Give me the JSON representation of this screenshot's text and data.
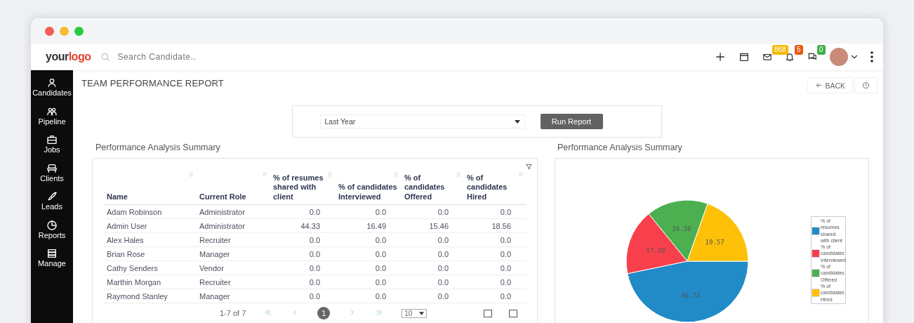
{
  "header": {
    "logo_dark": "your",
    "logo_accent": "logo",
    "search": {
      "placeholder": "Search Candidate.."
    },
    "badges": [
      {
        "count": "868",
        "color": "#f5b800"
      },
      {
        "count": "5",
        "color": "#e8590c"
      },
      {
        "count": "0",
        "color": "#3fae49"
      }
    ]
  },
  "sidebar": {
    "items": [
      {
        "label": "Candidates"
      },
      {
        "label": "Pipeline"
      },
      {
        "label": "Jobs"
      },
      {
        "label": "Clients"
      },
      {
        "label": "Leads"
      },
      {
        "label": "Reports"
      },
      {
        "label": "Manage"
      }
    ]
  },
  "page": {
    "title": "TEAM PERFORMANCE REPORT",
    "back_button": "BACK"
  },
  "filter": {
    "period": "Last Year",
    "run_button": "Run Report"
  },
  "table_section": {
    "heading": "Performance Analysis Summary",
    "columns": [
      "Name",
      "Current Role",
      "% of resumes shared with client",
      "% of candidates Interviewed",
      "% of candidates Offered",
      "% of candidates Hired"
    ],
    "rows": [
      [
        "Adam Robinson",
        "Administrator",
        "0.0",
        "0.0",
        "0.0",
        "0.0"
      ],
      [
        "Admin User",
        "Administrator",
        "44.33",
        "16.49",
        "15.46",
        "18.56"
      ],
      [
        "Alex Hales",
        "Recruiter",
        "0.0",
        "0.0",
        "0.0",
        "0.0"
      ],
      [
        "Brian Rose",
        "Manager",
        "0.0",
        "0.0",
        "0.0",
        "0.0"
      ],
      [
        "Cathy Senders",
        "Vendor",
        "0.0",
        "0.0",
        "0.0",
        "0.0"
      ],
      [
        "Marthin Morgan",
        "Recruiter",
        "0.0",
        "0.0",
        "0.0",
        "0.0"
      ],
      [
        "Raymond Stanley",
        "Manager",
        "0.0",
        "0.0",
        "0.0",
        "0.0"
      ]
    ],
    "pagination": {
      "range": "1-7 of 7",
      "pages": [
        {
          "label": "1",
          "selected": true
        }
      ],
      "page_size": "10"
    }
  },
  "chart_section": {
    "heading": "Performance Analysis Summary",
    "chart_data": {
      "type": "pie",
      "categories": [
        "% of resumes shared with client",
        "% of candidates Interviewed",
        "% of candidates Offered",
        "% of candidates Hired"
      ],
      "values": [
        46.74,
        17.39,
        16.3,
        19.57
      ],
      "colors": [
        "#208bc7",
        "#f7404c",
        "#4caf50",
        "#ffc107"
      ],
      "value_labels": [
        "46.74",
        "17.39",
        "16.30",
        "19.57"
      ]
    }
  }
}
